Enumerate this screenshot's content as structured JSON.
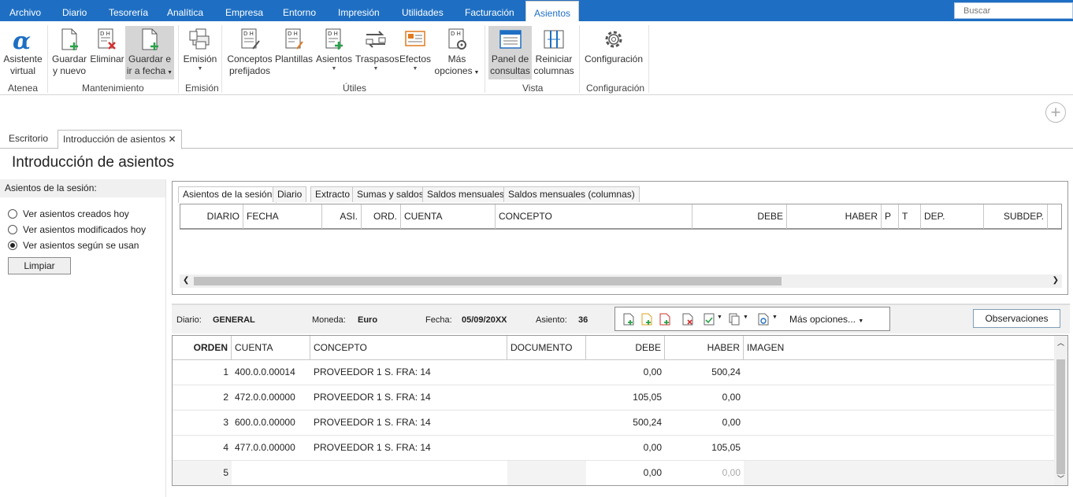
{
  "menubar": {
    "items": [
      "Archivo",
      "Diario",
      "Tesorería",
      "Analítica",
      "Empresa",
      "Entorno",
      "Impresión",
      "Utilidades",
      "Facturación",
      "Asientos"
    ],
    "search_placeholder": "Buscar"
  },
  "ribbon": {
    "asistente": {
      "line1": "Asistente",
      "line2": "virtual"
    },
    "guardar_nuevo": {
      "line1": "Guardar",
      "line2": "y nuevo"
    },
    "eliminar": "Eliminar",
    "guardar_fecha": {
      "line1": "Guardar e",
      "line2": "ir a fecha"
    },
    "emision": "Emisión",
    "conceptos": {
      "line1": "Conceptos",
      "line2": "prefijados"
    },
    "plantillas": "Plantillas",
    "asientos": "Asientos",
    "traspasos": "Traspasos",
    "efectos": "Efectos",
    "mas_opciones": {
      "line1": "Más",
      "line2": "opciones"
    },
    "panel": {
      "line1": "Panel de",
      "line2": "consultas"
    },
    "reiniciar": {
      "line1": "Reiniciar",
      "line2": "columnas"
    },
    "configuracion": "Configuración",
    "groups": {
      "atenea": "Atenea",
      "mantenimiento": "Mantenimiento",
      "emision": "Emisión",
      "utiles": "Útiles",
      "vista": "Vista",
      "configuracion": "Configuración"
    }
  },
  "tabs": {
    "escritorio": "Escritorio",
    "introduccion": "Introducción de asientos",
    "close": "✕"
  },
  "page_title": "Introducción de asientos",
  "left_panel": {
    "header": "Asientos de la sesión:",
    "options": [
      "Ver asientos creados hoy",
      "Ver asientos modificados hoy",
      "Ver asientos según se usan"
    ],
    "selected_index": 2,
    "clear_button": "Limpiar"
  },
  "top_grid": {
    "tabs": [
      "Asientos de la sesión",
      "Diario",
      "Extracto",
      "Sumas y saldos",
      "Saldos mensuales",
      "Saldos mensuales (columnas)"
    ],
    "columns": [
      "DIARIO",
      "FECHA",
      "ASI.",
      "ORD.",
      "CUENTA",
      "CONCEPTO",
      "DEBE",
      "HABER",
      "P",
      "T",
      "DEP.",
      "SUBDEP."
    ]
  },
  "info_bar": {
    "diario_label": "Diario:",
    "diario": "GENERAL",
    "moneda_label": "Moneda:",
    "moneda": "Euro",
    "fecha_label": "Fecha:",
    "fecha": "05/09/20XX",
    "asiento_label": "Asiento:",
    "asiento": "36",
    "mas_opciones": "Más opciones...",
    "observaciones": "Observaciones"
  },
  "entry_table": {
    "columns": [
      "ORDEN",
      "CUENTA",
      "CONCEPTO",
      "DOCUMENTO",
      "DEBE",
      "HABER",
      "IMAGEN"
    ],
    "rows": [
      {
        "orden": "1",
        "cuenta": "400.0.0.00014",
        "concepto": "PROVEEDOR 1 S. FRA:  14",
        "documento": "",
        "debe": "0,00",
        "haber": "500,24"
      },
      {
        "orden": "2",
        "cuenta": "472.0.0.00000",
        "concepto": "PROVEEDOR 1 S. FRA:  14",
        "documento": "",
        "debe": "105,05",
        "haber": "0,00"
      },
      {
        "orden": "3",
        "cuenta": "600.0.0.00000",
        "concepto": "PROVEEDOR 1 S. FRA:  14",
        "documento": "",
        "debe": "500,24",
        "haber": "0,00"
      },
      {
        "orden": "4",
        "cuenta": "477.0.0.00000",
        "concepto": "PROVEEDOR 1 S. FRA:  14",
        "documento": "",
        "debe": "0,00",
        "haber": "105,05"
      },
      {
        "orden": "5",
        "cuenta": "",
        "concepto": "",
        "documento": "",
        "debe": "0,00",
        "haber": "0,00"
      }
    ]
  },
  "colors": {
    "menubar": "#1e6fc3",
    "accent_green": "#2aa148",
    "accent_red": "#d32f2f"
  }
}
